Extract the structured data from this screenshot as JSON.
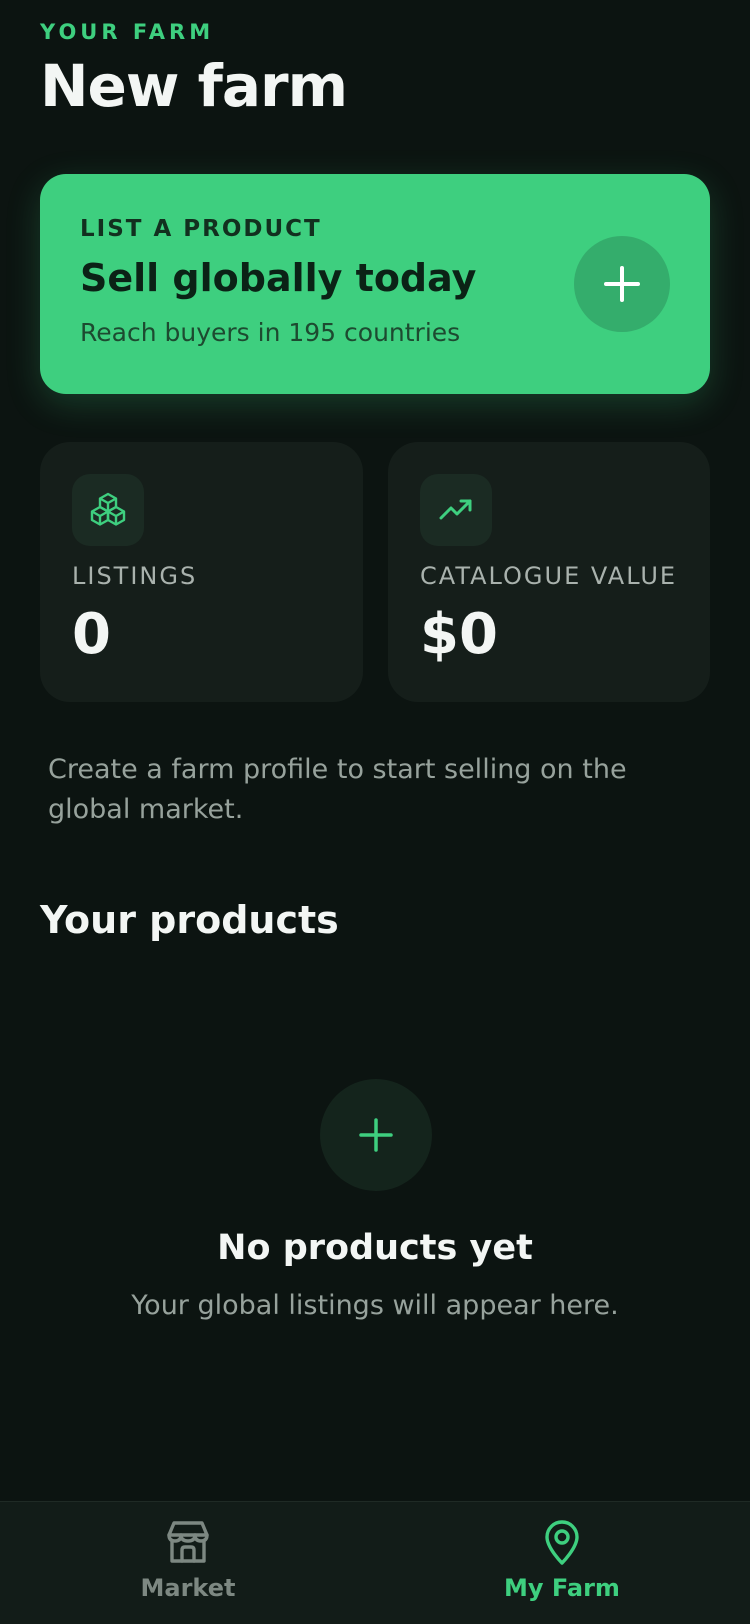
{
  "header": {
    "eyebrow": "YOUR FARM",
    "title": "New farm"
  },
  "hero": {
    "eyebrow": "LIST A PRODUCT",
    "title": "Sell globally today",
    "subtitle": "Reach buyers in 195 countries",
    "action_icon": "plus-icon"
  },
  "stats": [
    {
      "icon": "cubes-icon",
      "label": "LISTINGS",
      "value": "0"
    },
    {
      "icon": "trending-up-icon",
      "label": "CATALOGUE VALUE",
      "value": "$0"
    }
  ],
  "info_text": "Create a farm profile to start selling on the global market.",
  "products": {
    "section_title": "Your products",
    "empty_title": "No products yet",
    "empty_subtitle": "Your global listings will appear here."
  },
  "bottom_nav": {
    "items": [
      {
        "label": "Market",
        "icon": "storefront-icon",
        "active": false
      },
      {
        "label": "My Farm",
        "icon": "map-pin-icon",
        "active": true
      }
    ]
  },
  "colors": {
    "background": "#0c1411",
    "accent": "#3ecf7f",
    "card": "#151e1a",
    "muted_text": "#97a29c"
  }
}
